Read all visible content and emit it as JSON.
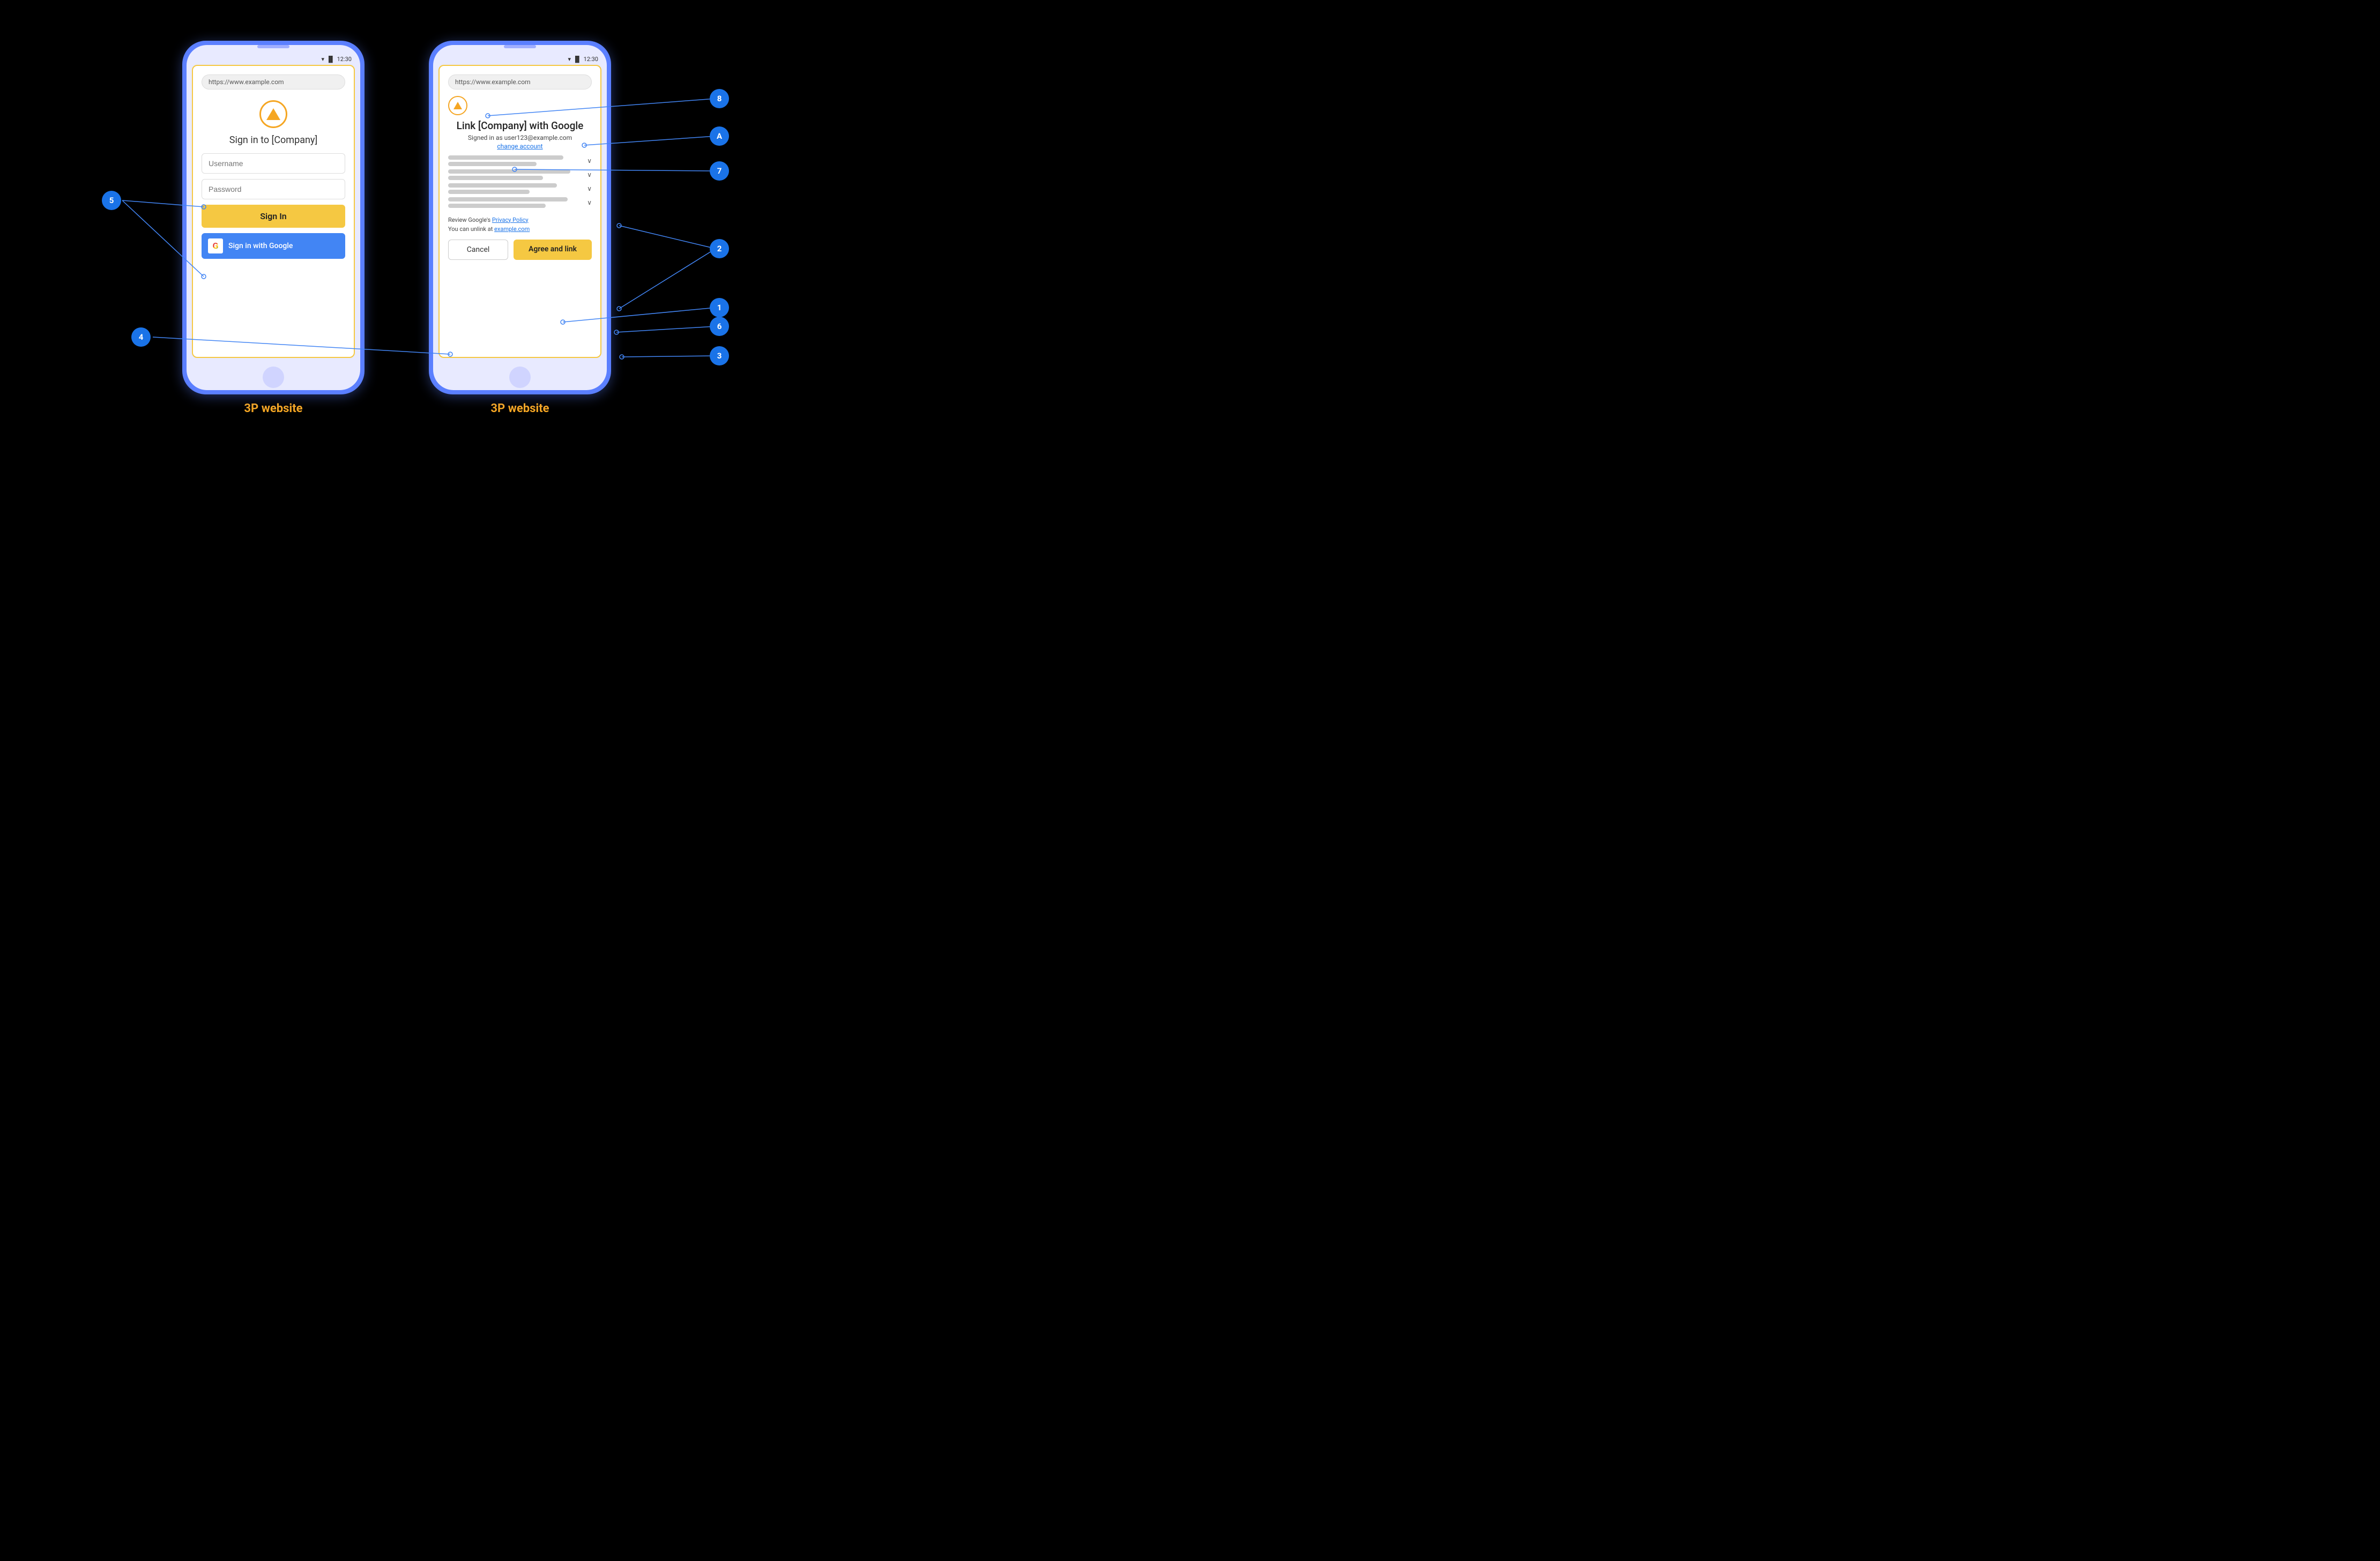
{
  "phones": {
    "left": {
      "label": "3P website",
      "url": "https://www.example.com",
      "time": "12:30",
      "title": "Sign in to [Company]",
      "username_placeholder": "Username",
      "password_placeholder": "Password",
      "sign_in_btn": "Sign In",
      "google_btn": "Sign in with Google"
    },
    "right": {
      "label": "3P website",
      "url": "https://www.example.com",
      "time": "12:30",
      "link_title": "Link [Company] with Google",
      "signed_in_text": "Signed in as user123@example.com",
      "change_account": "change account",
      "privacy_text": "Review Google's ",
      "privacy_link": "Privacy Policy",
      "unlink_text": "You can unlink at ",
      "unlink_link": "example.com",
      "cancel_btn": "Cancel",
      "agree_btn": "Agree and link"
    }
  },
  "annotations": {
    "num1": "1",
    "num2": "2",
    "num3": "3",
    "num4": "4",
    "num5": "5",
    "num6": "6",
    "num7": "7",
    "num8": "8",
    "numA": "A"
  },
  "scopes": [
    {
      "line1_width": "85%",
      "line2_width": "65%"
    },
    {
      "line1_width": "90%",
      "line2_width": "70%"
    },
    {
      "line1_width": "80%",
      "line2_width": "60%"
    },
    {
      "line1_width": "88%",
      "line2_width": "72%"
    }
  ]
}
